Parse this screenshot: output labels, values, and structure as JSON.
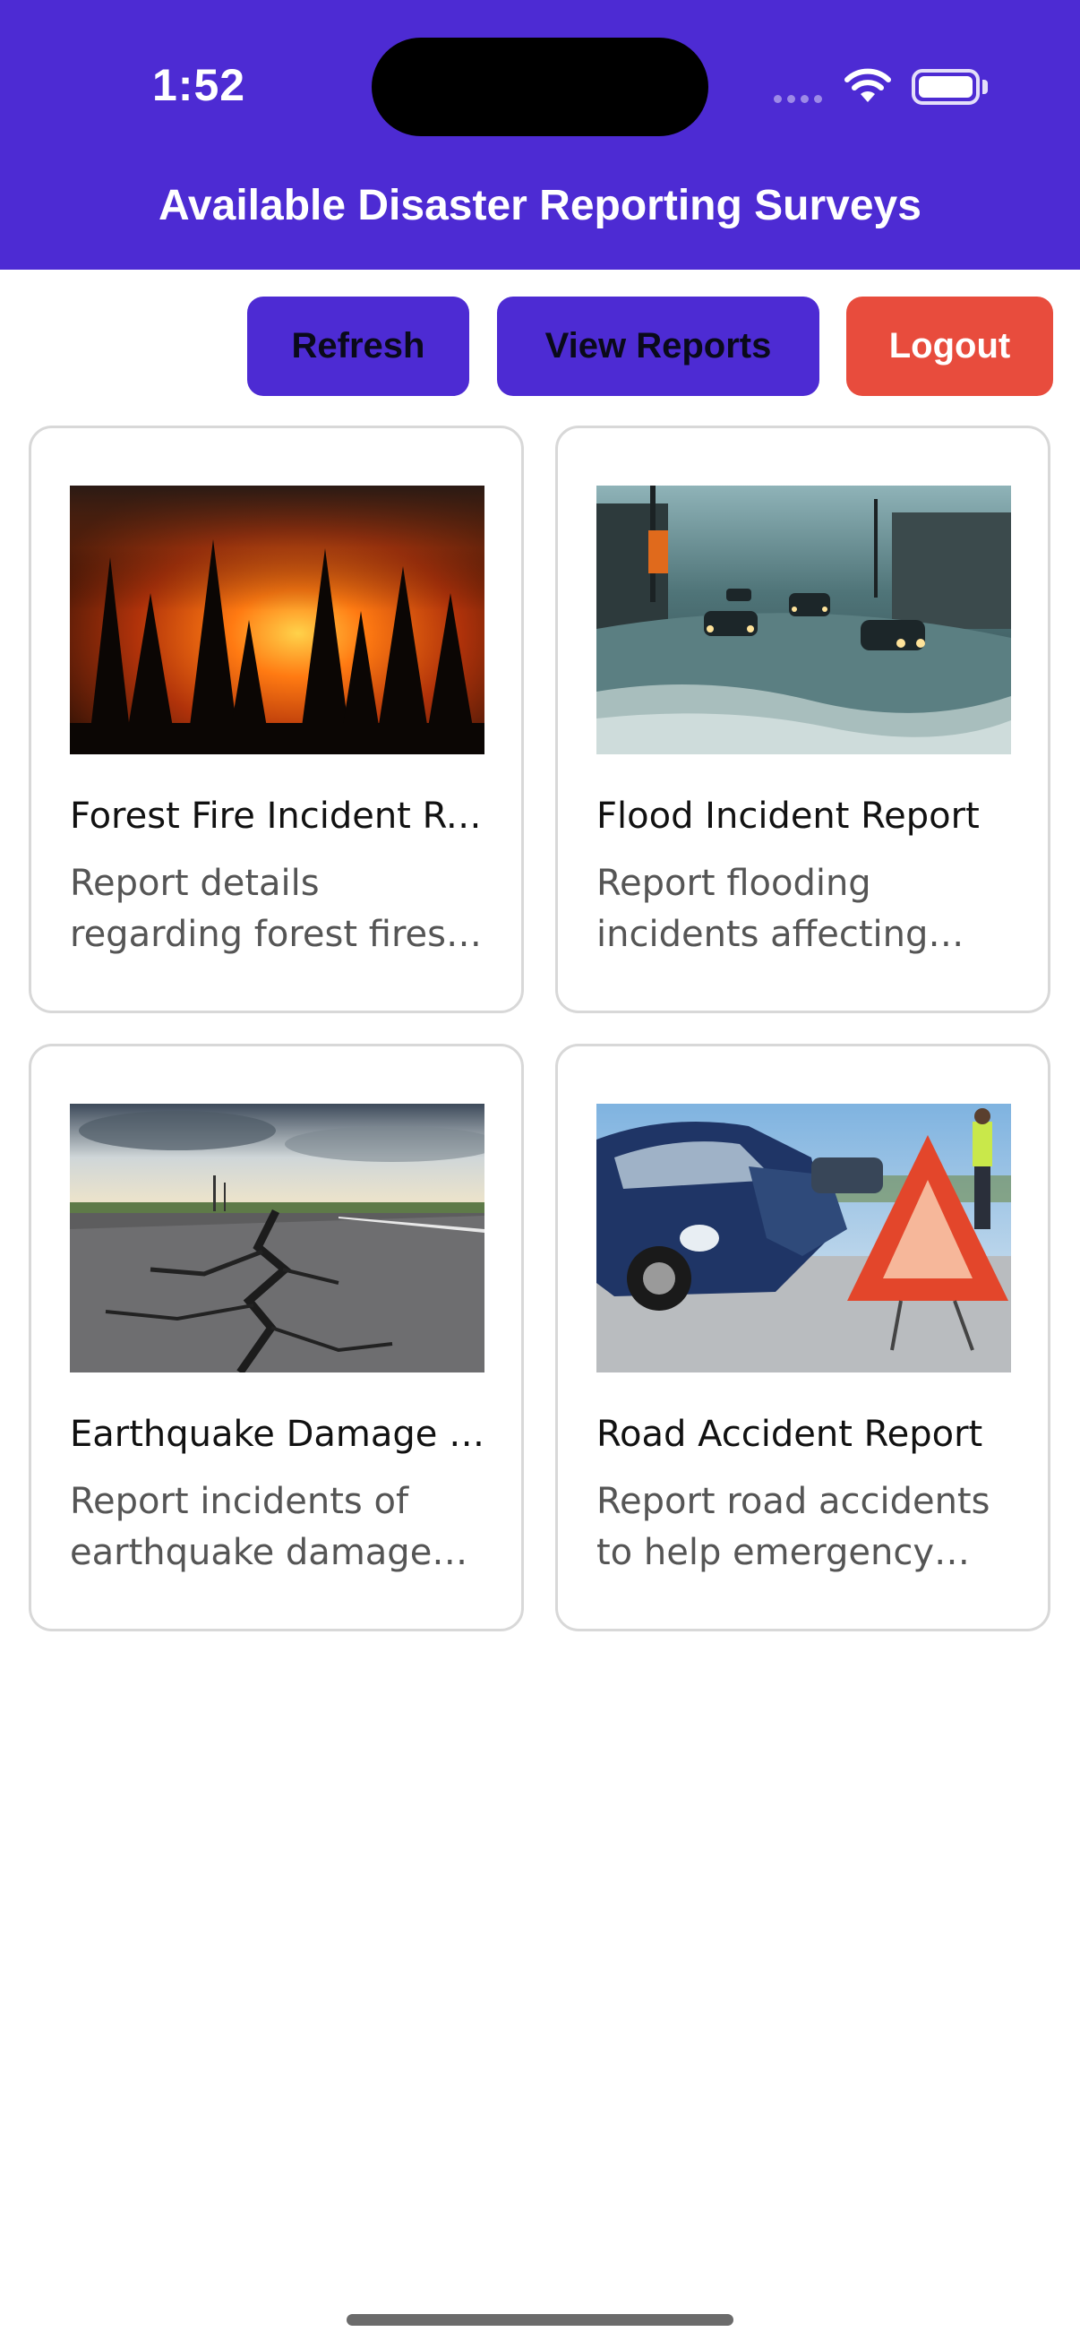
{
  "status_bar": {
    "time": "1:52"
  },
  "header": {
    "title": "Available Disaster Reporting Surveys"
  },
  "actions": {
    "refresh": "Refresh",
    "view_reports": "View Reports",
    "logout": "Logout"
  },
  "colors": {
    "primary": "#4d2bd3",
    "danger": "#e84c3d"
  },
  "surveys": [
    {
      "title": "Forest Fire Incident Report",
      "description": "Report details regarding forest fires and wildfire incidents",
      "image": "forest-fire-photo"
    },
    {
      "title": "Flood Incident Report",
      "description": "Report flooding incidents affecting infrastructure and homes",
      "image": "flood-photo"
    },
    {
      "title": "Earthquake Damage Report",
      "description": "Report incidents of earthquake damage for assessment",
      "image": "earthquake-crack-photo"
    },
    {
      "title": "Road Accident Report",
      "description": "Report road accidents to help emergency response teams",
      "image": "road-accident-photo"
    }
  ]
}
